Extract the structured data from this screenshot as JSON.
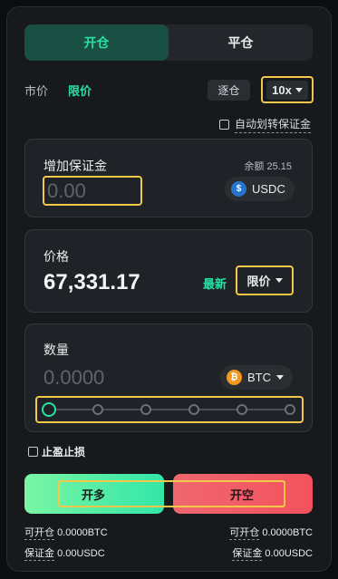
{
  "tabs": {
    "open": "开仓",
    "close": "平仓"
  },
  "order_types": {
    "market": "市价",
    "limit": "限价"
  },
  "margin_mode": "逐仓",
  "leverage": "10x",
  "auto_transfer_label": "自动划转保证金",
  "margin_card": {
    "label": "增加保证金",
    "balance": "余额 25.15",
    "placeholder": "0.00",
    "currency": "USDC",
    "currency_icon": "$"
  },
  "price_card": {
    "label": "价格",
    "value": "67,331.17",
    "latest": "最新",
    "order_type": "限价"
  },
  "qty_card": {
    "label": "数量",
    "placeholder": "0.0000",
    "currency": "BTC",
    "currency_icon": "₿",
    "slider_percent": 0
  },
  "tp_sl_label": "止盈止损",
  "actions": {
    "long": "开多",
    "short": "开空"
  },
  "stats": {
    "left_open_label": "可开仓",
    "left_open_value": "0.0000BTC",
    "left_margin_label": "保证金",
    "left_margin_value": "0.00USDC",
    "right_open_label": "可开仓",
    "right_open_value": "0.0000BTC",
    "right_margin_label": "保证金",
    "right_margin_value": "0.00USDC"
  },
  "colors": {
    "accent": "#28e0a4",
    "highlight": "#f2c84b",
    "long": "#33e6a8",
    "short": "#f3525d"
  }
}
